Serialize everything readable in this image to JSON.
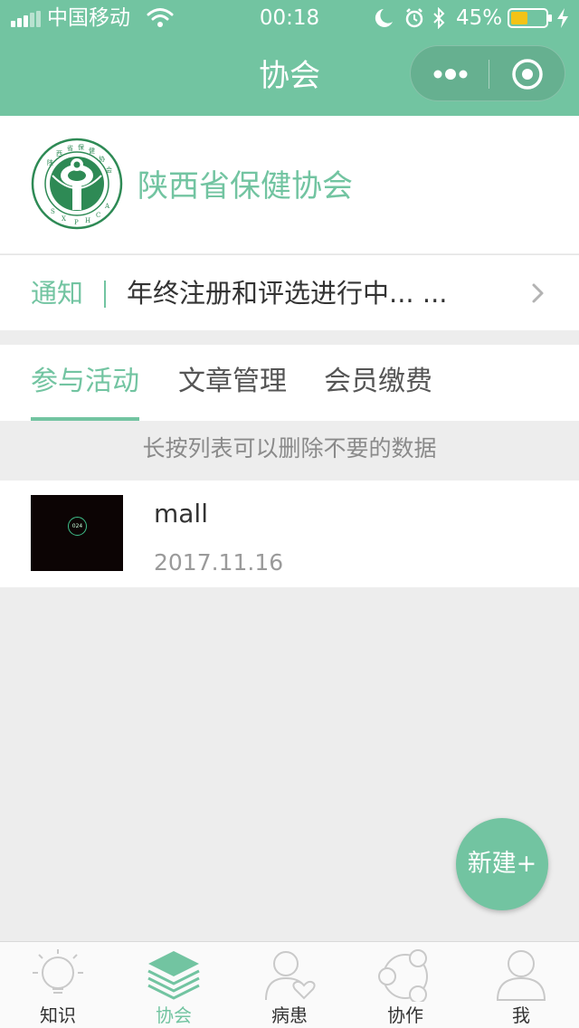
{
  "status_bar": {
    "carrier": "中国移动",
    "time": "00:18",
    "battery": "45%"
  },
  "nav": {
    "title": "协会"
  },
  "organization": {
    "name": "陕西省保健协会"
  },
  "notice": {
    "label": "通知",
    "text": "年终注册和评选进行中... ..."
  },
  "tabs": [
    {
      "label": "参与活动",
      "active": true
    },
    {
      "label": "文章管理",
      "active": false
    },
    {
      "label": "会员缴费",
      "active": false
    }
  ],
  "hint": "长按列表可以删除不要的数据",
  "list": [
    {
      "title": "mall",
      "date": "2017.11.16",
      "thumb_text": "024"
    }
  ],
  "fab": {
    "label": "新建+"
  },
  "tab_bar": [
    {
      "label": "知识",
      "icon": "bulb-icon",
      "active": false
    },
    {
      "label": "协会",
      "icon": "layers-icon",
      "active": true
    },
    {
      "label": "病患",
      "icon": "patient-icon",
      "active": false
    },
    {
      "label": "协作",
      "icon": "collaborate-icon",
      "active": false
    },
    {
      "label": "我",
      "icon": "user-icon",
      "active": false
    }
  ],
  "colors": {
    "accent": "#72c4a1",
    "background": "#ededed"
  }
}
